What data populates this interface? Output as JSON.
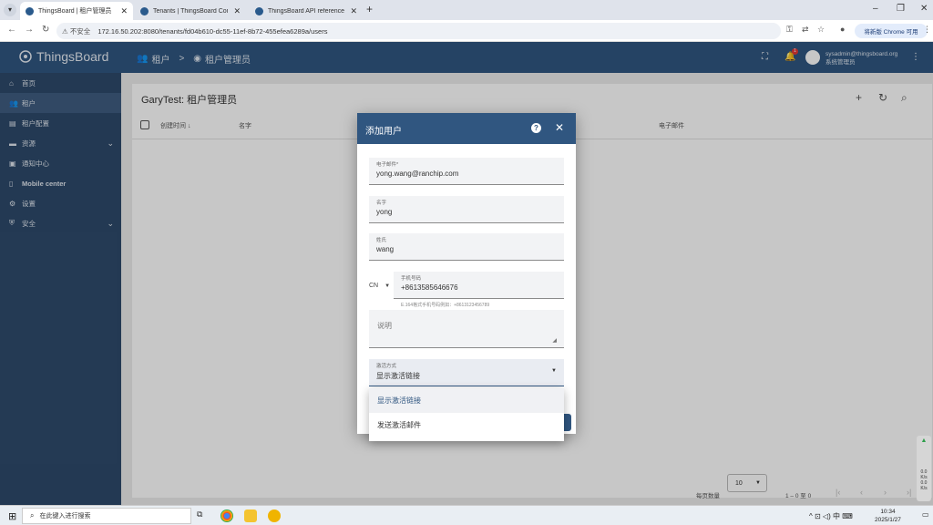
{
  "browser": {
    "tabs": [
      {
        "title": "ThingsBoard | 租户管理员",
        "active": true
      },
      {
        "title": "Tenants | ThingsBoard Comm",
        "active": false
      },
      {
        "title": "ThingsBoard API reference |",
        "active": false
      }
    ],
    "new_tab": "+",
    "minimize": "–",
    "restore": "❐",
    "close": "✕",
    "not_secure": "不安全",
    "url": "172.16.50.202:8080/tenants/fd04b610-dc55-11ef-8b72-455efea6289a/users",
    "update_button": "将新版 Chrome 可用"
  },
  "app": {
    "logo_text": "ThingsBoard",
    "breadcrumb": {
      "first": "租户",
      "second": "租户管理员",
      "separator": ">"
    },
    "notification_count": "1",
    "user_email": "sysadmin@thingsboard.org",
    "user_role": "系统管理员"
  },
  "sidebar": {
    "items": [
      {
        "label": "首页",
        "icon": "home-icon"
      },
      {
        "label": "租户",
        "icon": "group-icon",
        "active": true
      },
      {
        "label": "租户配置",
        "icon": "profile-icon"
      },
      {
        "label": "资源",
        "icon": "folder-icon",
        "expandable": true
      },
      {
        "label": "通知中心",
        "icon": "inbox-icon"
      },
      {
        "label": "Mobile center",
        "icon": "phone-icon"
      },
      {
        "label": "设置",
        "icon": "gear-icon"
      },
      {
        "label": "安全",
        "icon": "shield-icon",
        "expandable": true
      }
    ]
  },
  "page": {
    "title": "GaryTest: 租户管理员",
    "columns": {
      "created": "创建时间",
      "name": "名字",
      "email": "电子邮件"
    },
    "pager": {
      "per_page_label": "每页数量",
      "per_page": "10",
      "range": "1 – 0 至 0"
    }
  },
  "dialog": {
    "title": "添加用户",
    "email": {
      "label": "电子邮件*",
      "value": "yong.wang@ranchip.com"
    },
    "first_name": {
      "label": "名字",
      "value": "yong"
    },
    "last_name": {
      "label": "姓氏",
      "value": "wang"
    },
    "country": "CN",
    "phone": {
      "label": "手机号码",
      "value": "+8613585646676",
      "hint": "E.164格式手机号码例如：+8613123456789"
    },
    "description": {
      "placeholder": "说明"
    },
    "activation": {
      "label": "激活方式",
      "value": "显示激活链接"
    },
    "activation_options": [
      "显示激活链接",
      "发送激活邮件"
    ]
  },
  "widget": {
    "up": "0.0",
    "up_unit": "K/s",
    "down": "0.0",
    "down_unit": "K/s"
  },
  "taskbar": {
    "search_placeholder": "在此键入进行搜索",
    "ime": "中",
    "time": "10:34",
    "date": "2025/1/27"
  }
}
